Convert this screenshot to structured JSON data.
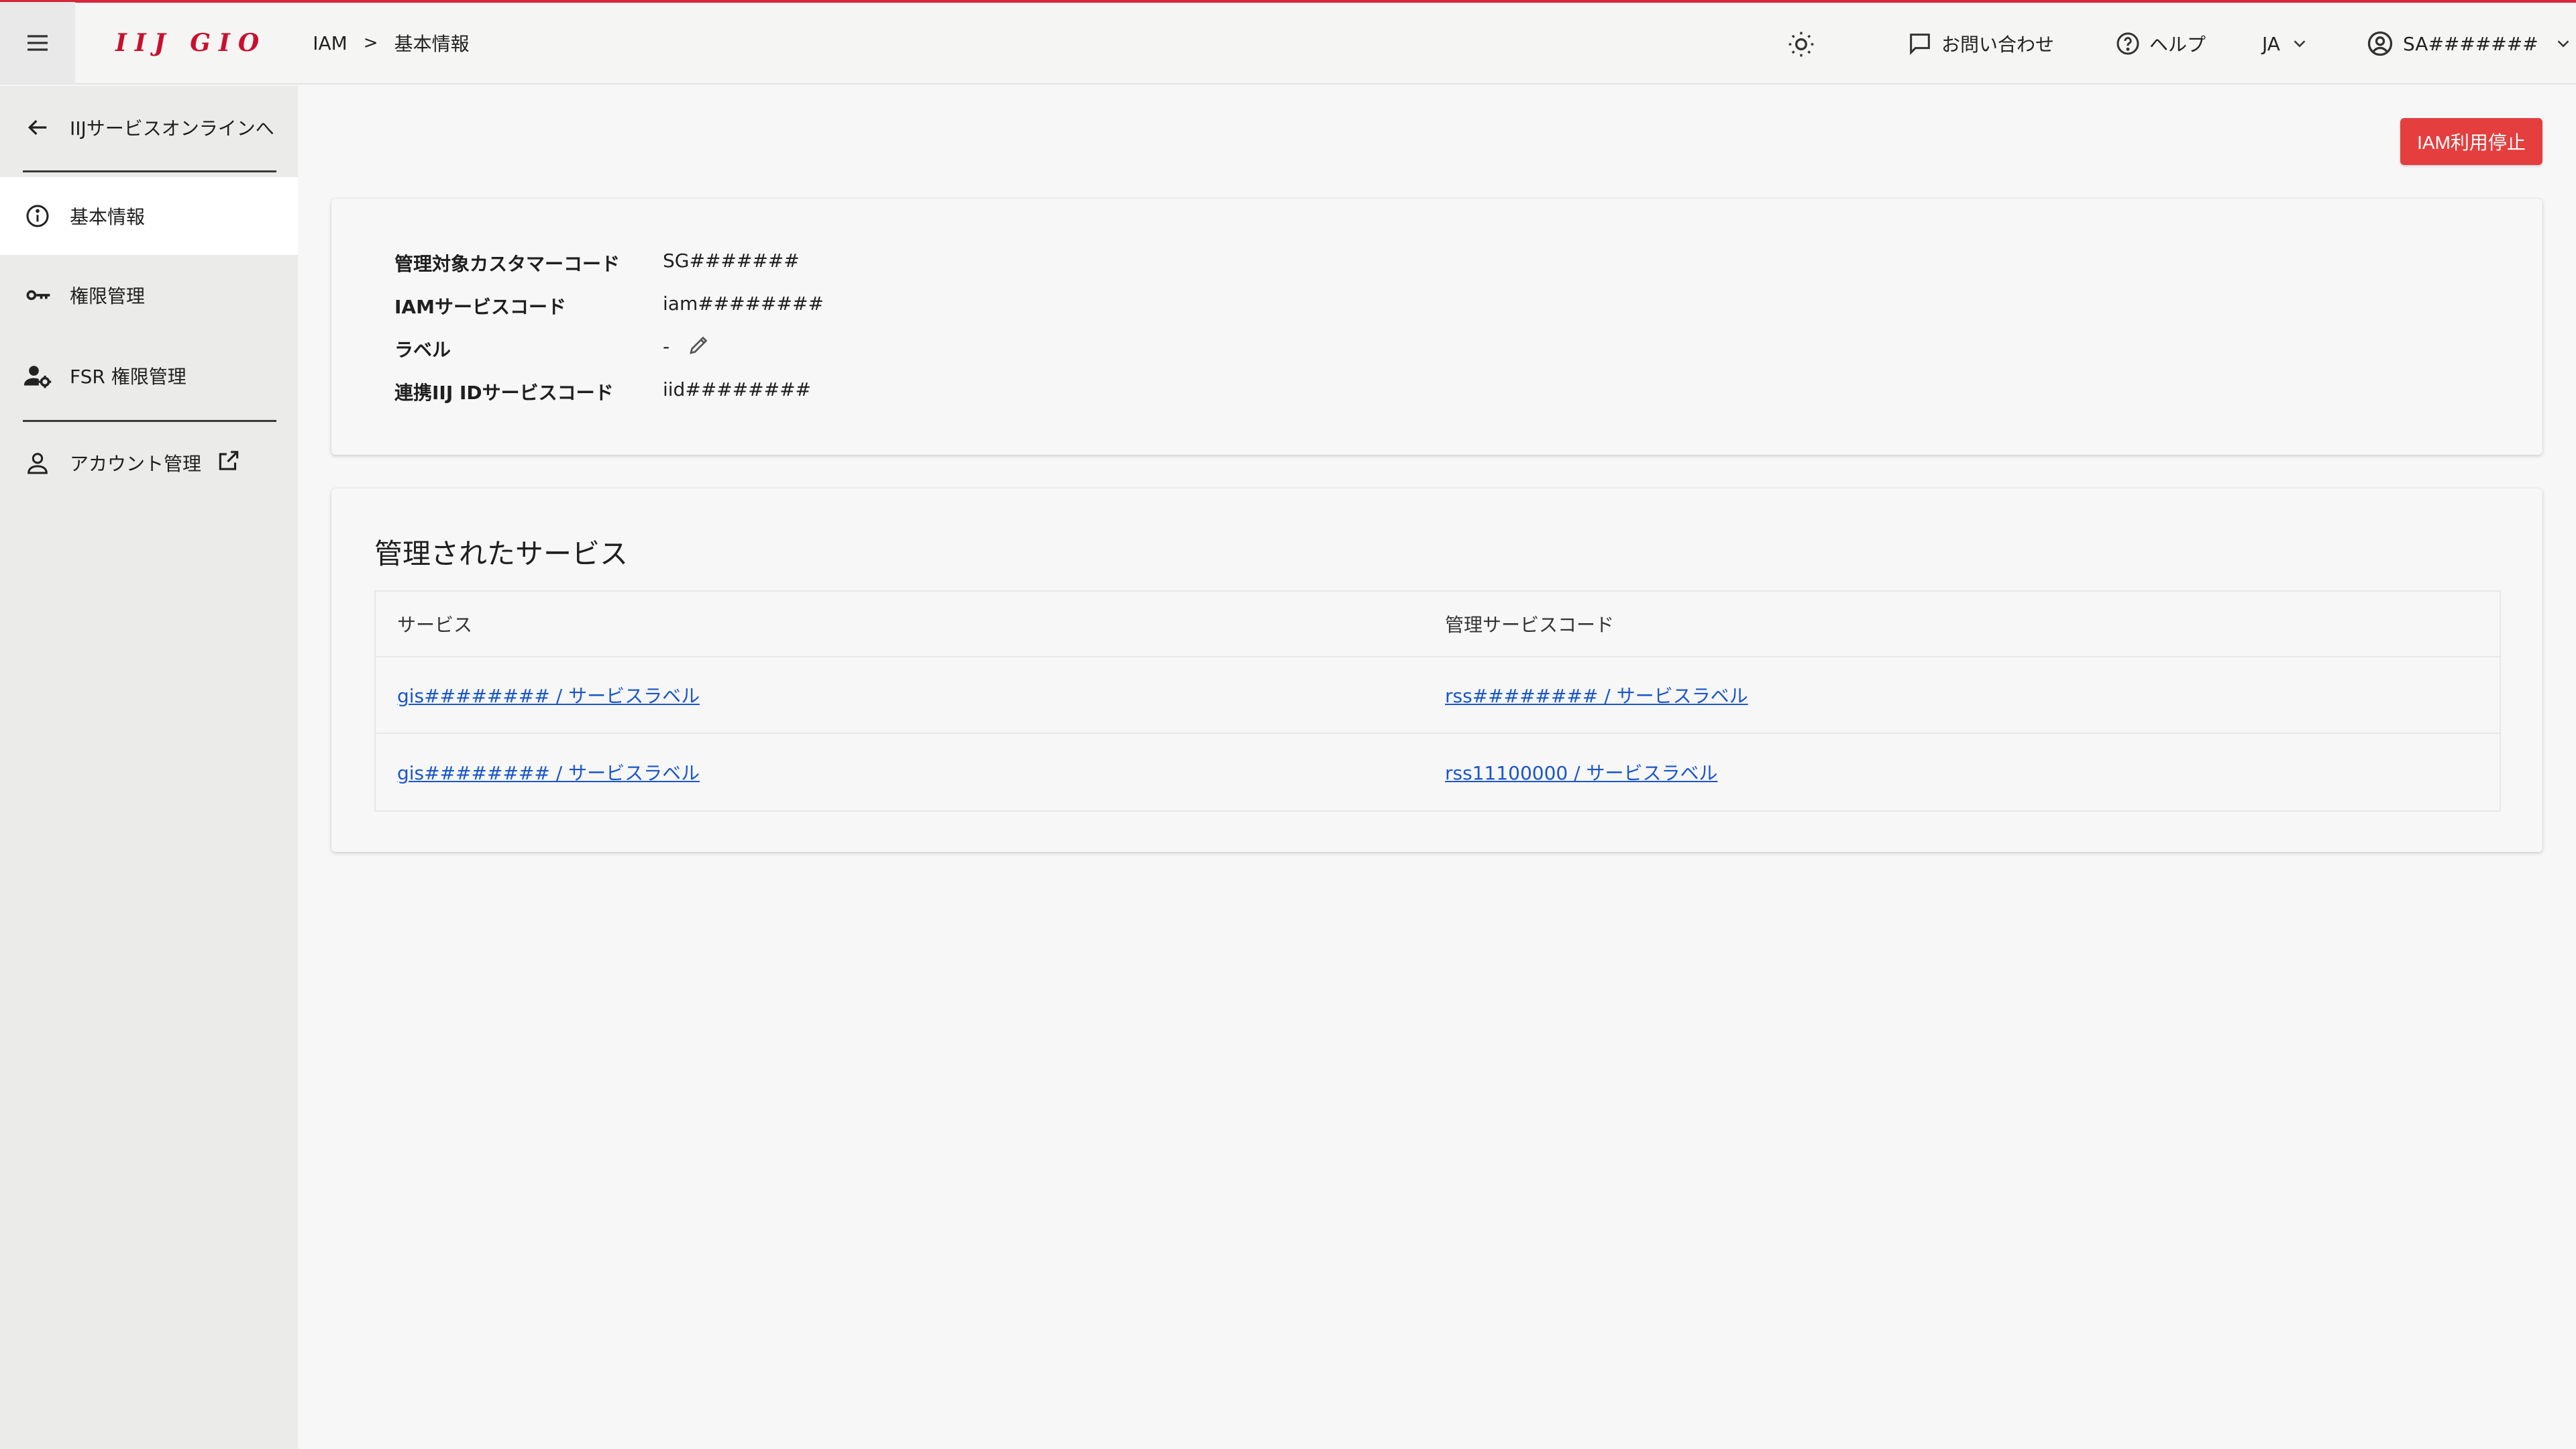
{
  "header": {
    "logo": "IIJ GIO",
    "breadcrumb": [
      "IAM",
      "基本情報"
    ],
    "breadcrumb_sep": ">",
    "contact_label": "お問い合わせ",
    "help_label": "ヘルプ",
    "language": "JA",
    "user": "SA#######"
  },
  "sidebar": {
    "back_label": "IIJサービスオンラインへ",
    "items": [
      {
        "label": "基本情報",
        "icon": "info-icon",
        "active": true
      },
      {
        "label": "権限管理",
        "icon": "key-icon"
      },
      {
        "label": "FSR 権限管理",
        "icon": "user-settings-icon"
      }
    ],
    "account_label": "アカウント管理"
  },
  "actions": {
    "stop_iam": "IAM利用停止"
  },
  "info": {
    "rows": [
      {
        "key": "管理対象カスタマーコード",
        "value": "SG#######"
      },
      {
        "key": "IAMサービスコード",
        "value": "iam########"
      },
      {
        "key": "ラベル",
        "value": "-"
      },
      {
        "key": "連携IIJ IDサービスコード",
        "value": "iid########"
      }
    ]
  },
  "services": {
    "title": "管理されたサービス",
    "columns": [
      "サービス",
      "管理サービスコード"
    ],
    "rows": [
      [
        "gis######## / サービスラベル",
        "rss######## / サービスラベル"
      ],
      [
        "gis######## / サービスラベル",
        "rss11100000 / サービスラベル"
      ]
    ]
  },
  "colors": {
    "accent": "#e53e3e",
    "brand": "#c8102e",
    "link": "#1a56c9"
  }
}
